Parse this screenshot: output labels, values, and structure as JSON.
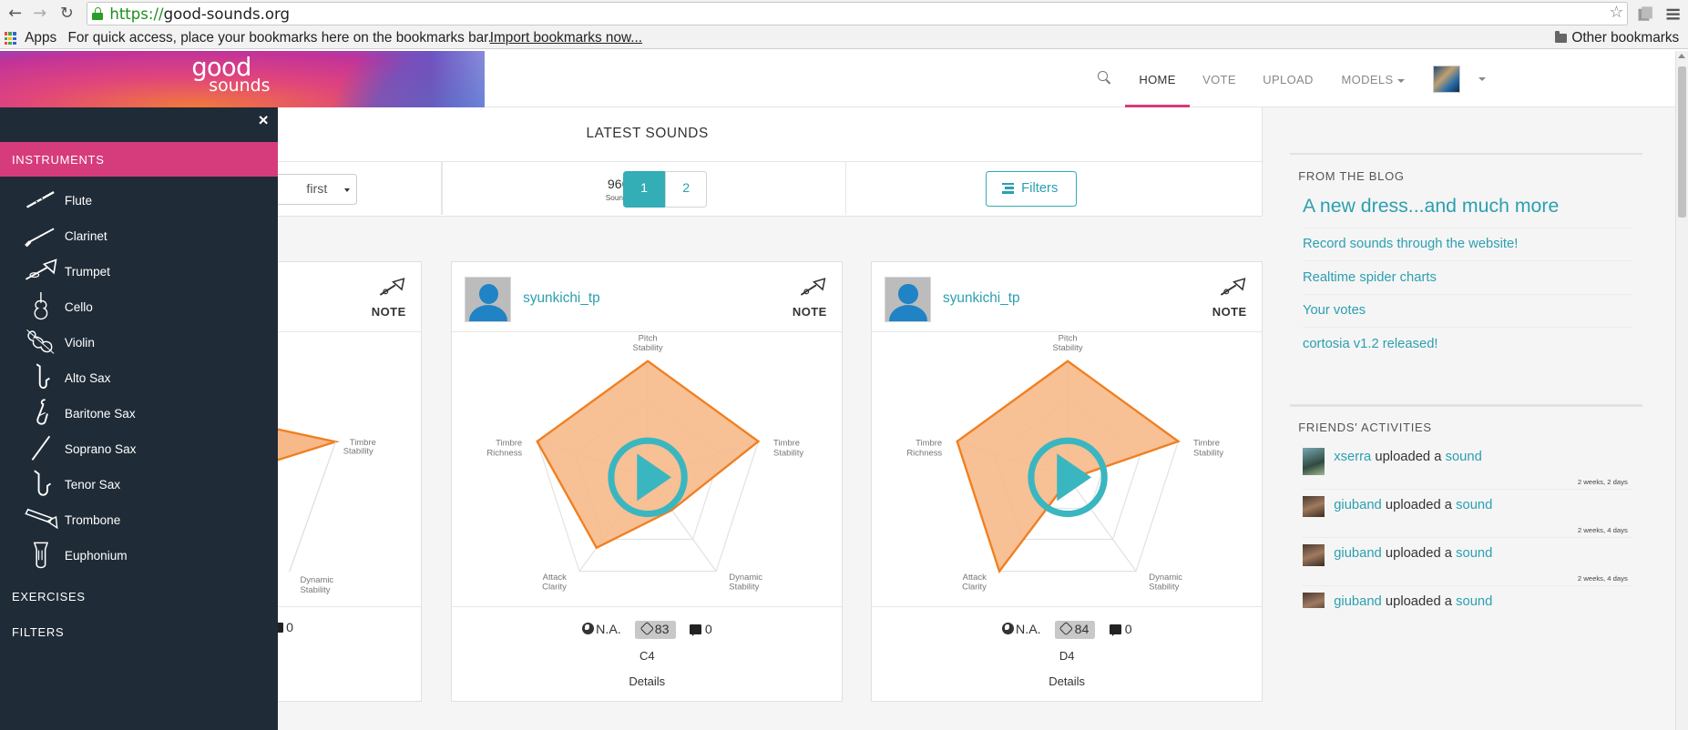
{
  "browser": {
    "url_scheme": "https://",
    "url_host": "good-sounds.org",
    "bookmarks": {
      "apps": "Apps",
      "hint": "For quick access, place your bookmarks here on the bookmarks bar.",
      "import_link": "Import bookmarks now...",
      "other": "Other bookmarks"
    }
  },
  "site": {
    "logo_line1": "good",
    "logo_line2": "sounds",
    "nav": {
      "home": "HOME",
      "vote": "VOTE",
      "upload": "UPLOAD",
      "models": "MODELS"
    },
    "accent": "#d63c7b",
    "teal": "#2c9fb0"
  },
  "latest": {
    "title": "LATEST SOUNDS",
    "sort_value": "first",
    "count": "966",
    "count_label": "Sounds",
    "pages": [
      "1",
      "2"
    ],
    "filters_label": "Filters"
  },
  "cards": [
    {
      "user": "",
      "type": "NOTE",
      "comments": "0"
    },
    {
      "user": "syunkichi_tp",
      "type": "NOTE",
      "quality": "N.A.",
      "score": "83",
      "comments": "0",
      "note": "C4",
      "details": "Details",
      "radar": {
        "axes": [
          "Pitch Stability",
          "Timbre Stability",
          "Dynamic Stability",
          "Attack Clarity",
          "Timbre Richness"
        ],
        "values": [
          1.0,
          1.0,
          0.35,
          0.75,
          1.0
        ]
      }
    },
    {
      "user": "syunkichi_tp",
      "type": "NOTE",
      "quality": "N.A.",
      "score": "84",
      "comments": "0",
      "note": "D4",
      "details": "Details",
      "radar": {
        "axes": [
          "Pitch Stability",
          "Timbre Stability",
          "Dynamic Stability",
          "Attack Clarity",
          "Timbre Richness"
        ],
        "values": [
          1.0,
          1.0,
          0.0,
          1.0,
          1.0
        ]
      }
    }
  ],
  "blog": {
    "title": "FROM THE BLOG",
    "items": [
      "A new dress...and much more",
      "Record sounds through the website!",
      "Realtime spider charts",
      "Your votes",
      "cortosia v1.2 released!"
    ]
  },
  "friends": {
    "title": "FRIENDS' ACTIVITIES",
    "items": [
      {
        "user": "xserra",
        "action": "uploaded a",
        "object": "sound",
        "when": "2 weeks, 2 days"
      },
      {
        "user": "giuband",
        "action": "uploaded a",
        "object": "sound",
        "when": "2 weeks, 4 days"
      },
      {
        "user": "giuband",
        "action": "uploaded a",
        "object": "sound",
        "when": "2 weeks, 4 days"
      },
      {
        "user": "giuband",
        "action": "uploaded a",
        "object": "sound",
        "when": ""
      }
    ]
  },
  "instruments_panel": {
    "close": "×",
    "title": "INSTRUMENTS",
    "items": [
      {
        "name": "Flute",
        "icon": "flute-icon"
      },
      {
        "name": "Clarinet",
        "icon": "clarinet-icon"
      },
      {
        "name": "Trumpet",
        "icon": "trumpet-icon"
      },
      {
        "name": "Cello",
        "icon": "cello-icon"
      },
      {
        "name": "Violin",
        "icon": "violin-icon"
      },
      {
        "name": "Alto Sax",
        "icon": "alto-sax-icon"
      },
      {
        "name": "Baritone Sax",
        "icon": "baritone-sax-icon"
      },
      {
        "name": "Soprano Sax",
        "icon": "soprano-sax-icon"
      },
      {
        "name": "Tenor Sax",
        "icon": "tenor-sax-icon"
      },
      {
        "name": "Trombone",
        "icon": "trombone-icon"
      },
      {
        "name": "Euphonium",
        "icon": "euphonium-icon"
      }
    ],
    "exercises": "EXERCISES",
    "filters": "FILTERS"
  }
}
